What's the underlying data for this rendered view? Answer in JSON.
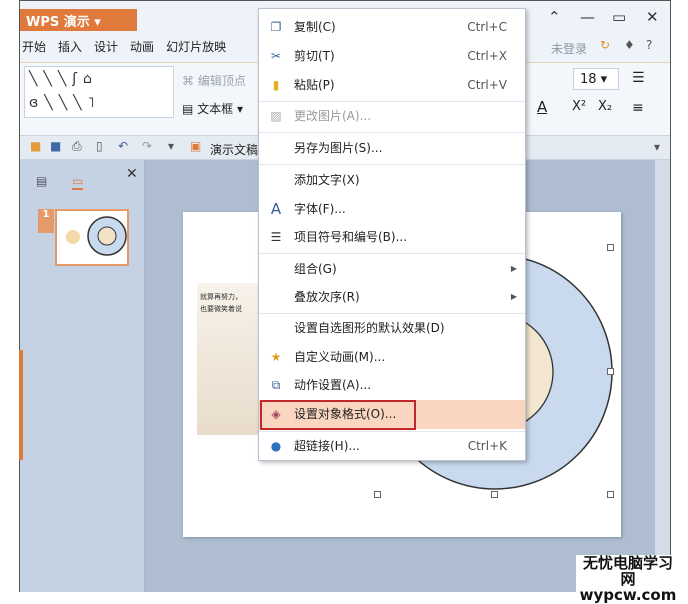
{
  "app": {
    "title": "WPS 演示",
    "menu_arrow": "▾"
  },
  "window_controls": {
    "collapse": "⌃",
    "minimize": "—",
    "maximize": "▭",
    "close": "✕"
  },
  "tabs": [
    "开始",
    "插入",
    "设计",
    "动画",
    "幻灯片放映"
  ],
  "account": {
    "login": "未登录",
    "help": "?"
  },
  "ribbon": {
    "edit_points": "编辑顶点",
    "textbox": "文本框",
    "font_size": "18",
    "superscript": "X²",
    "subscript": "X₂",
    "font_color": "A"
  },
  "quick_access": {
    "doc_name": "演示文稿"
  },
  "panel": {
    "close": "✕",
    "slide_number": "1"
  },
  "slide": {
    "caption_line1": "就算再努力，",
    "caption_line2": "也要微笑着说"
  },
  "context_menu": {
    "copy": {
      "label": "复制(C)",
      "shortcut": "Ctrl+C"
    },
    "cut": {
      "label": "剪切(T)",
      "shortcut": "Ctrl+X"
    },
    "paste": {
      "label": "粘贴(P)",
      "shortcut": "Ctrl+V"
    },
    "change_picture": {
      "label": "更改图片(A)..."
    },
    "save_as_picture": {
      "label": "另存为图片(S)..."
    },
    "add_text": {
      "label": "添加文字(X)"
    },
    "font": {
      "label": "字体(F)..."
    },
    "bullets": {
      "label": "项目符号和编号(B)..."
    },
    "group": {
      "label": "组合(G)"
    },
    "order": {
      "label": "叠放次序(R)"
    },
    "default_effect": {
      "label": "设置自选图形的默认效果(D)"
    },
    "custom_animation": {
      "label": "自定义动画(M)..."
    },
    "action_settings": {
      "label": "动作设置(A)..."
    },
    "format_object": {
      "label": "设置对象格式(O)..."
    },
    "hyperlink": {
      "label": "超链接(H)...",
      "shortcut": "Ctrl+K"
    }
  },
  "watermark": {
    "line1": "无忧电脑学习网",
    "line2": "wypcw.com"
  },
  "colors": {
    "accent": "#e07a3c",
    "highlight": "#fad5bf",
    "redbox": "#c0282c",
    "ring": "#c9d9ee"
  }
}
